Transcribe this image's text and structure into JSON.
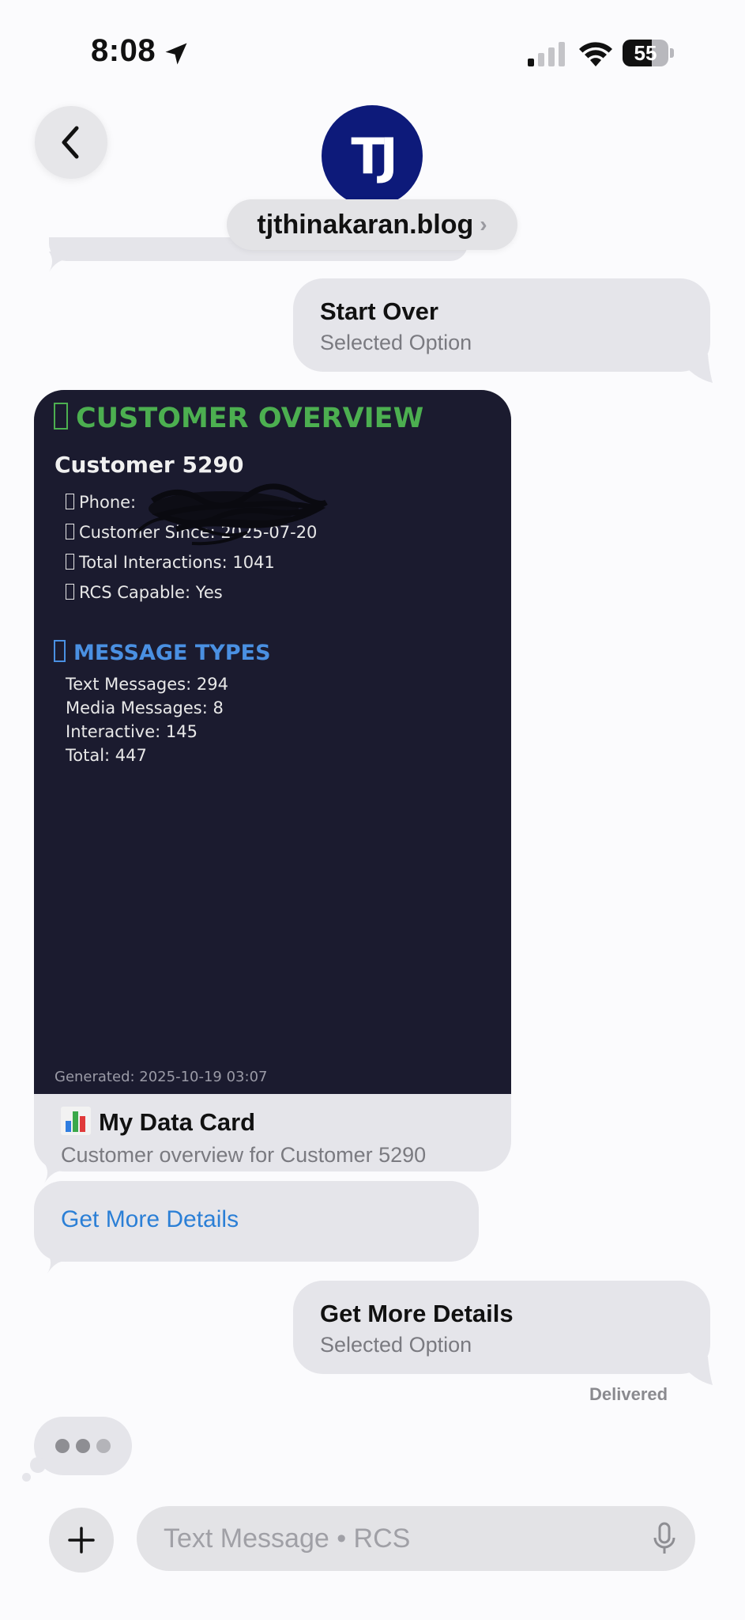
{
  "status_bar": {
    "time": "8:08",
    "battery": "55"
  },
  "header": {
    "avatar_initials": "TJ",
    "contact_name": "tjthinakaran.blog",
    "contact_chevron": "›"
  },
  "messages": {
    "sent_1": {
      "title": "Start Over",
      "subtitle": "Selected Option"
    },
    "card": {
      "image": {
        "title": "CUSTOMER OVERVIEW",
        "customer": "Customer 5290",
        "phone": "Phone:",
        "customer_since": "Customer Since: 2025-07-20",
        "total_interactions": "Total Interactions: 1041",
        "rcs_capable": "RCS Capable: Yes",
        "message_types_title": "MESSAGE TYPES",
        "text_messages": "Text Messages: 294",
        "media_messages": "Media Messages: 8",
        "interactive": "Interactive: 145",
        "total": "Total: 447",
        "generated": "Generated: 2025-10-19 03:07"
      },
      "title_emoji": "📊",
      "title": "My Data Card",
      "subtitle": "Customer overview for Customer 5290"
    },
    "suggested_reply": "Get More Details",
    "sent_2": {
      "title": "Get More Details",
      "subtitle": "Selected Option"
    },
    "delivered": "Delivered"
  },
  "compose": {
    "placeholder": "Text Message • RCS"
  },
  "colors": {
    "bubble": "#e5e5ea",
    "card_background": "#1b1b2f",
    "overview_green": "#4caf50",
    "message_types_blue": "#4a90e2",
    "link_blue": "#2b7fd6",
    "avatar_navy": "#0d1a7a"
  },
  "icons": [
    "location-arrow-icon",
    "cellular-signal-icon",
    "wifi-icon",
    "battery-icon",
    "chevron-left-icon",
    "plus-icon",
    "microphone-icon"
  ]
}
